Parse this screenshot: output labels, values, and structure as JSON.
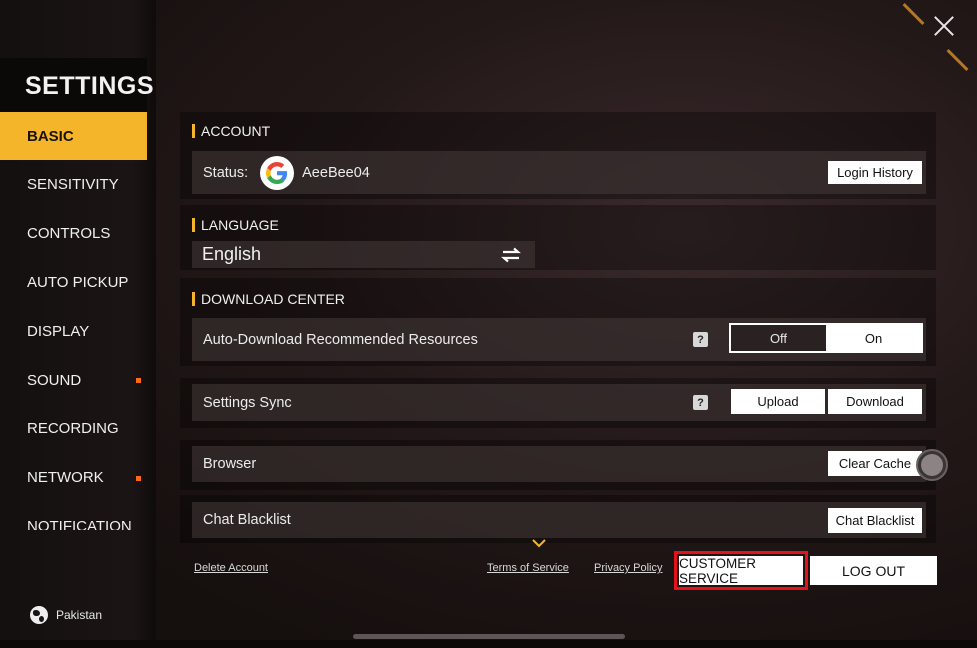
{
  "sidebar": {
    "title": "SETTINGS",
    "items": [
      {
        "label": "BASIC",
        "active": true,
        "dot": false
      },
      {
        "label": "SENSITIVITY",
        "active": false,
        "dot": false
      },
      {
        "label": "CONTROLS",
        "active": false,
        "dot": false
      },
      {
        "label": "AUTO PICKUP",
        "active": false,
        "dot": false
      },
      {
        "label": "DISPLAY",
        "active": false,
        "dot": false
      },
      {
        "label": "SOUND",
        "active": false,
        "dot": true
      },
      {
        "label": "RECORDING",
        "active": false,
        "dot": false
      },
      {
        "label": "NETWORK",
        "active": false,
        "dot": true
      },
      {
        "label": "NOTIFICATION",
        "active": false,
        "dot": false
      }
    ],
    "region": "Pakistan"
  },
  "account": {
    "heading": "ACCOUNT",
    "status_label": "Status:",
    "username": "AeeBee04",
    "provider_icon": "google-icon",
    "login_history_label": "Login History"
  },
  "language": {
    "heading": "LANGUAGE",
    "value": "English"
  },
  "download_center": {
    "heading": "DOWNLOAD CENTER",
    "auto_download": {
      "label": "Auto-Download Recommended Resources",
      "help": "?",
      "off_label": "Off",
      "on_label": "On",
      "selected": "On"
    },
    "settings_sync": {
      "label": "Settings Sync",
      "help": "?",
      "upload_label": "Upload",
      "download_label": "Download"
    },
    "browser": {
      "label": "Browser",
      "clear_cache_label": "Clear Cache"
    },
    "chat_blacklist": {
      "label": "Chat Blacklist",
      "button_label": "Chat Blacklist"
    }
  },
  "footer": {
    "delete_account": "Delete Account",
    "terms": "Terms of Service",
    "privacy": "Privacy Policy",
    "customer_service": "CUSTOMER SERVICE",
    "logout": "LOG OUT"
  },
  "colors": {
    "accent": "#f5b52a",
    "highlight_border": "#e2131a",
    "notification_dot": "#ff6a1a"
  }
}
